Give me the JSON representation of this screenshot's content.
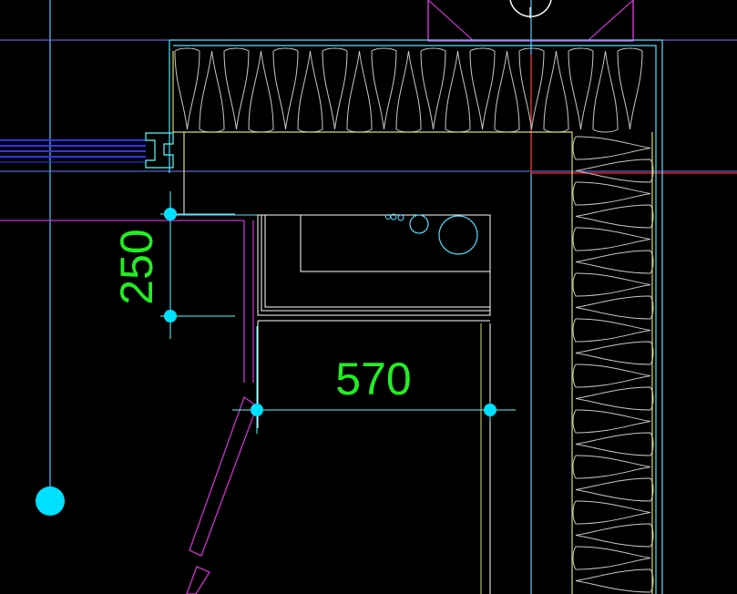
{
  "dimensions": {
    "vertical": {
      "value": "250"
    },
    "horizontal": {
      "value": "570"
    }
  },
  "colors": {
    "background": "#000000",
    "dimension_text": "#22ee22",
    "dimension_line": "#55ffff",
    "grip": "#00e0ff",
    "wall": "#dada66",
    "insulation": "#cccccc",
    "door": "#cc33cc",
    "guide_line": "#7a7aff",
    "crosshair": "#ff2222",
    "window": "#2222ff"
  }
}
